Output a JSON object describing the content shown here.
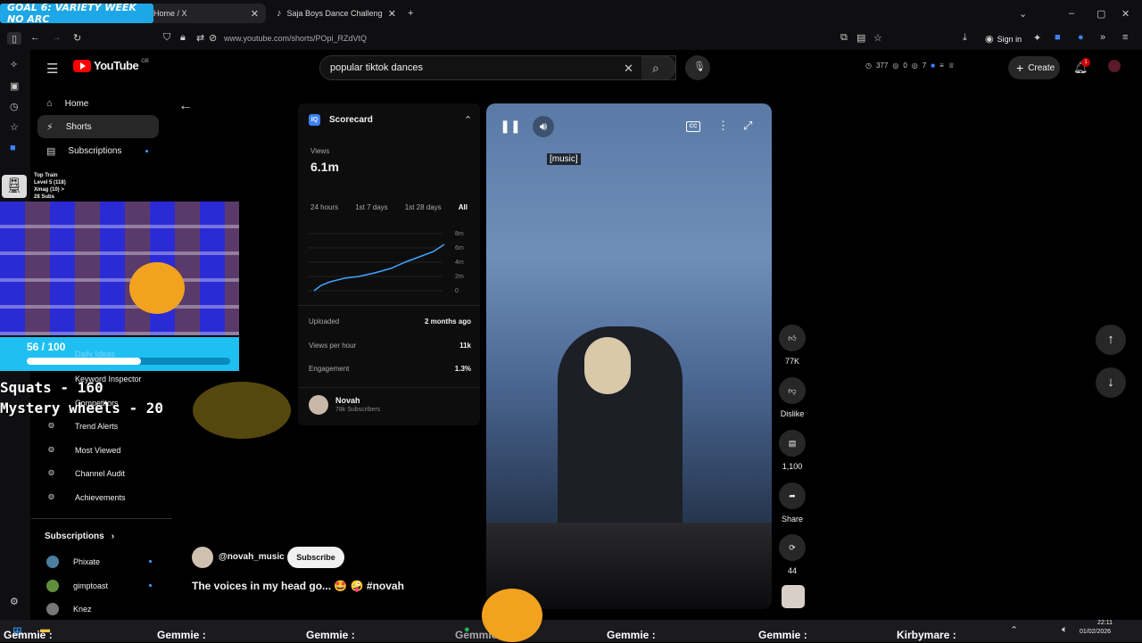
{
  "browser": {
    "tabs": [
      {
        "label": "Home / X"
      },
      {
        "label": "Saja Boys Dance Challenge - Jo"
      }
    ],
    "url": "www.youtube.com/shorts/POpi_RZdVtQ",
    "sign_in": "Sign in"
  },
  "overlay": {
    "goal_banner": "GOAL 6: VARIETY WEEK NO ARC",
    "train_lines": [
      "Top Train",
      "Level 5 (118)",
      "Xmag (10) >",
      "28 Subs"
    ],
    "progress_text": "56 / 100",
    "progress_fraction": 0.56,
    "squats": "Squats - 160",
    "mystery": "Mystery wheels - 20"
  },
  "youtube": {
    "logo_text": "YouTube",
    "country": "GB",
    "search_value": "popular tiktok dances",
    "header_stats": {
      "views": "377",
      "likes": "0",
      "subs": "7"
    },
    "create_label": "Create",
    "notif_count": "1",
    "nav": [
      {
        "label": "Home"
      },
      {
        "label": "Shorts"
      },
      {
        "label": "Subscriptions"
      }
    ],
    "tool_items": [
      {
        "label": "Daily Ideas"
      },
      {
        "label": "Keyword Inspector"
      },
      {
        "label": "Competitors"
      },
      {
        "label": "Trend Alerts"
      },
      {
        "label": "Most Viewed"
      },
      {
        "label": "Channel Audit"
      },
      {
        "label": "Achievements"
      }
    ],
    "subscriptions_heading": "Subscriptions",
    "subscriptions": [
      {
        "label": "Phixate"
      },
      {
        "label": "gimptoast"
      },
      {
        "label": "Knez"
      }
    ]
  },
  "scorecard": {
    "title": "Scorecard",
    "views_label": "Views",
    "views_value": "6.1m",
    "ranges": [
      "24 hours",
      "1st 7 days",
      "1st 28 days",
      "All"
    ],
    "y_ticks": [
      "8m",
      "6m",
      "4m",
      "2m",
      "0"
    ],
    "rows": [
      {
        "label": "Uploaded",
        "value": "2 months ago"
      },
      {
        "label": "Views per hour",
        "value": "11k"
      },
      {
        "label": "Engagement",
        "value": "1.3%"
      }
    ],
    "channel_name": "Novah",
    "channel_subs": "78k Subscribers"
  },
  "video": {
    "caption": "[music]",
    "channel_handle": "@novah_music",
    "subscribe_label": "Subscribe",
    "title": "The voices in my head go... 🤩 🤪 #novah"
  },
  "rail": {
    "likes": "77K",
    "dislike": "Dislike",
    "comments": "1,100",
    "share": "Share",
    "remix": "44"
  },
  "chat": {
    "items": [
      "Gemmie :",
      "Gemmie :",
      "Gemmie :",
      "Gemmie :",
      "Gemmie :",
      "Gemmie :",
      "Kirbymare :"
    ]
  },
  "taskbar": {
    "time": "22:11",
    "date": "01/02/2026"
  }
}
